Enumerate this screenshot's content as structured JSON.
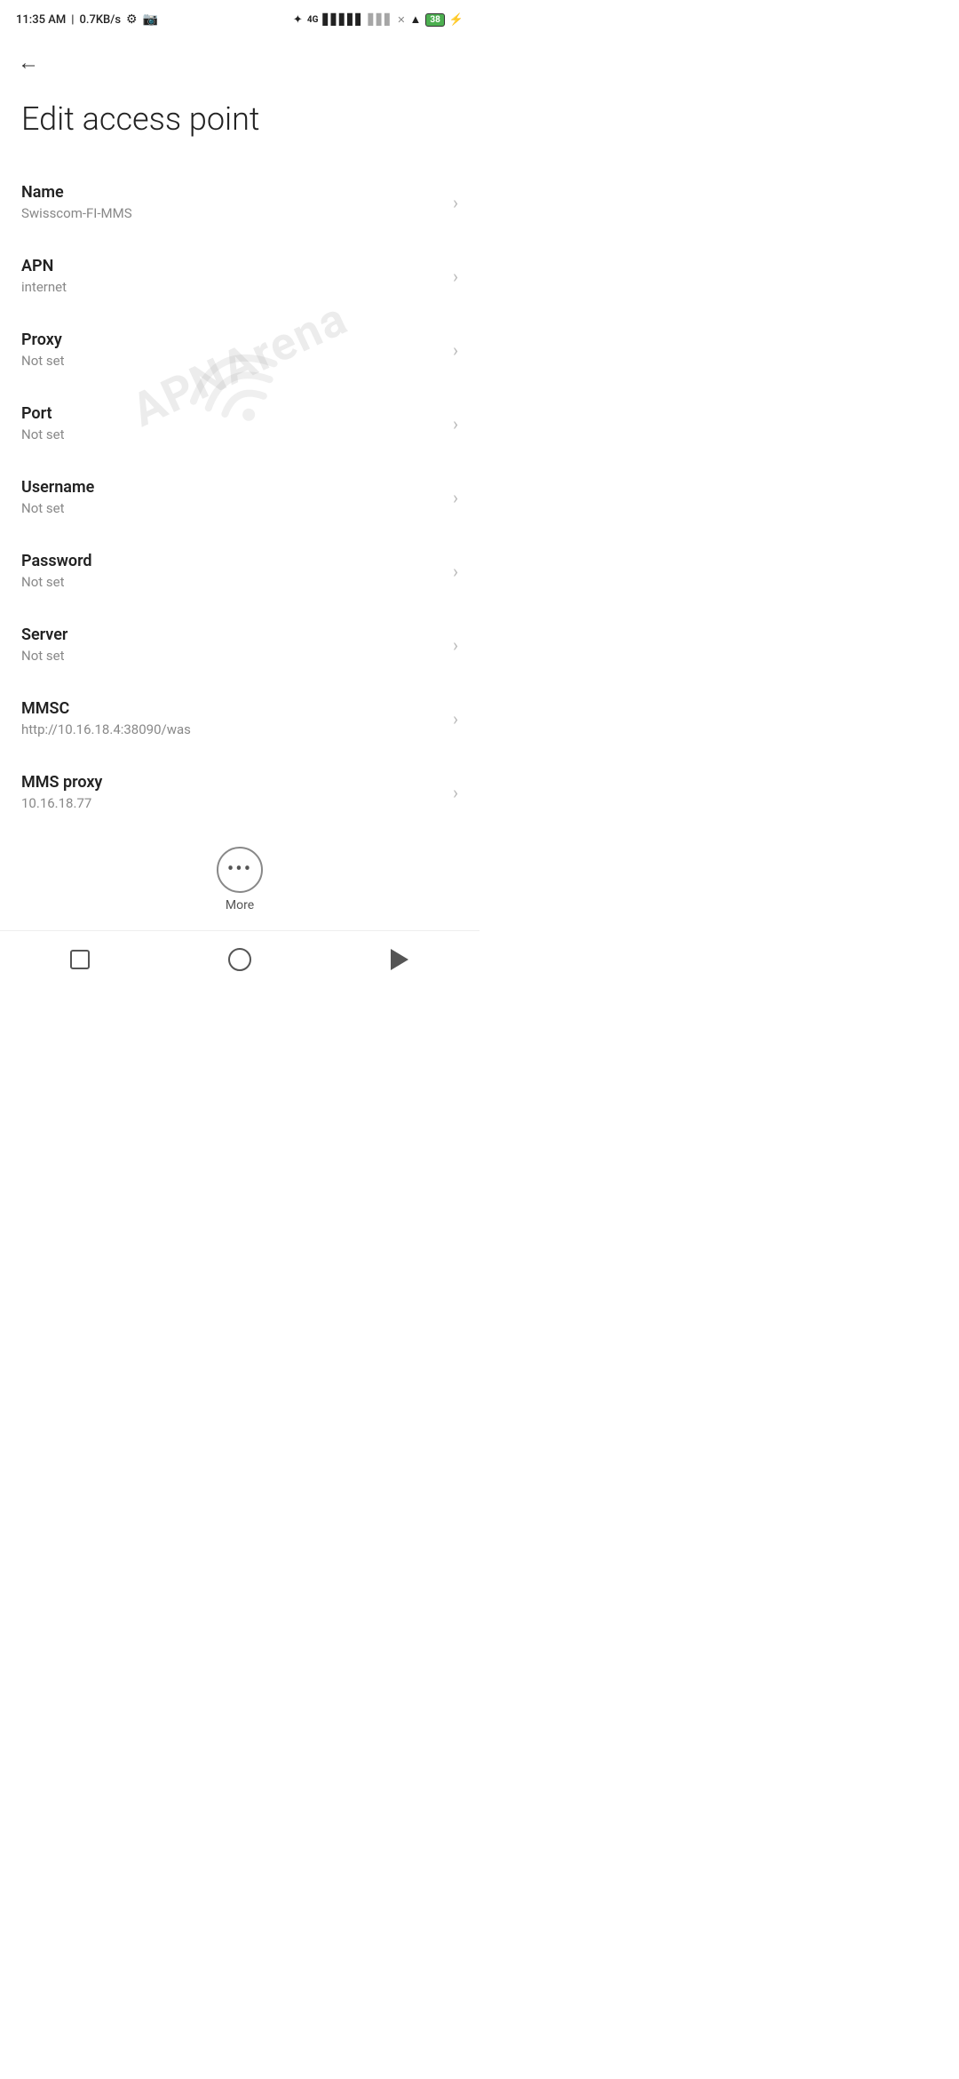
{
  "statusBar": {
    "time": "11:35 AM",
    "speed": "0.7KB/s",
    "battery": "38"
  },
  "nav": {
    "backLabel": "←"
  },
  "pageTitle": "Edit access point",
  "settings": [
    {
      "label": "Name",
      "value": "Swisscom-FI-MMS"
    },
    {
      "label": "APN",
      "value": "internet"
    },
    {
      "label": "Proxy",
      "value": "Not set"
    },
    {
      "label": "Port",
      "value": "Not set"
    },
    {
      "label": "Username",
      "value": "Not set"
    },
    {
      "label": "Password",
      "value": "Not set"
    },
    {
      "label": "Server",
      "value": "Not set"
    },
    {
      "label": "MMSC",
      "value": "http://10.16.18.4:38090/was"
    },
    {
      "label": "MMS proxy",
      "value": "10.16.18.77"
    }
  ],
  "more": {
    "label": "More"
  },
  "watermark": "APNArena",
  "bottomNav": {
    "square": "square",
    "circle": "circle",
    "triangle": "triangle"
  }
}
